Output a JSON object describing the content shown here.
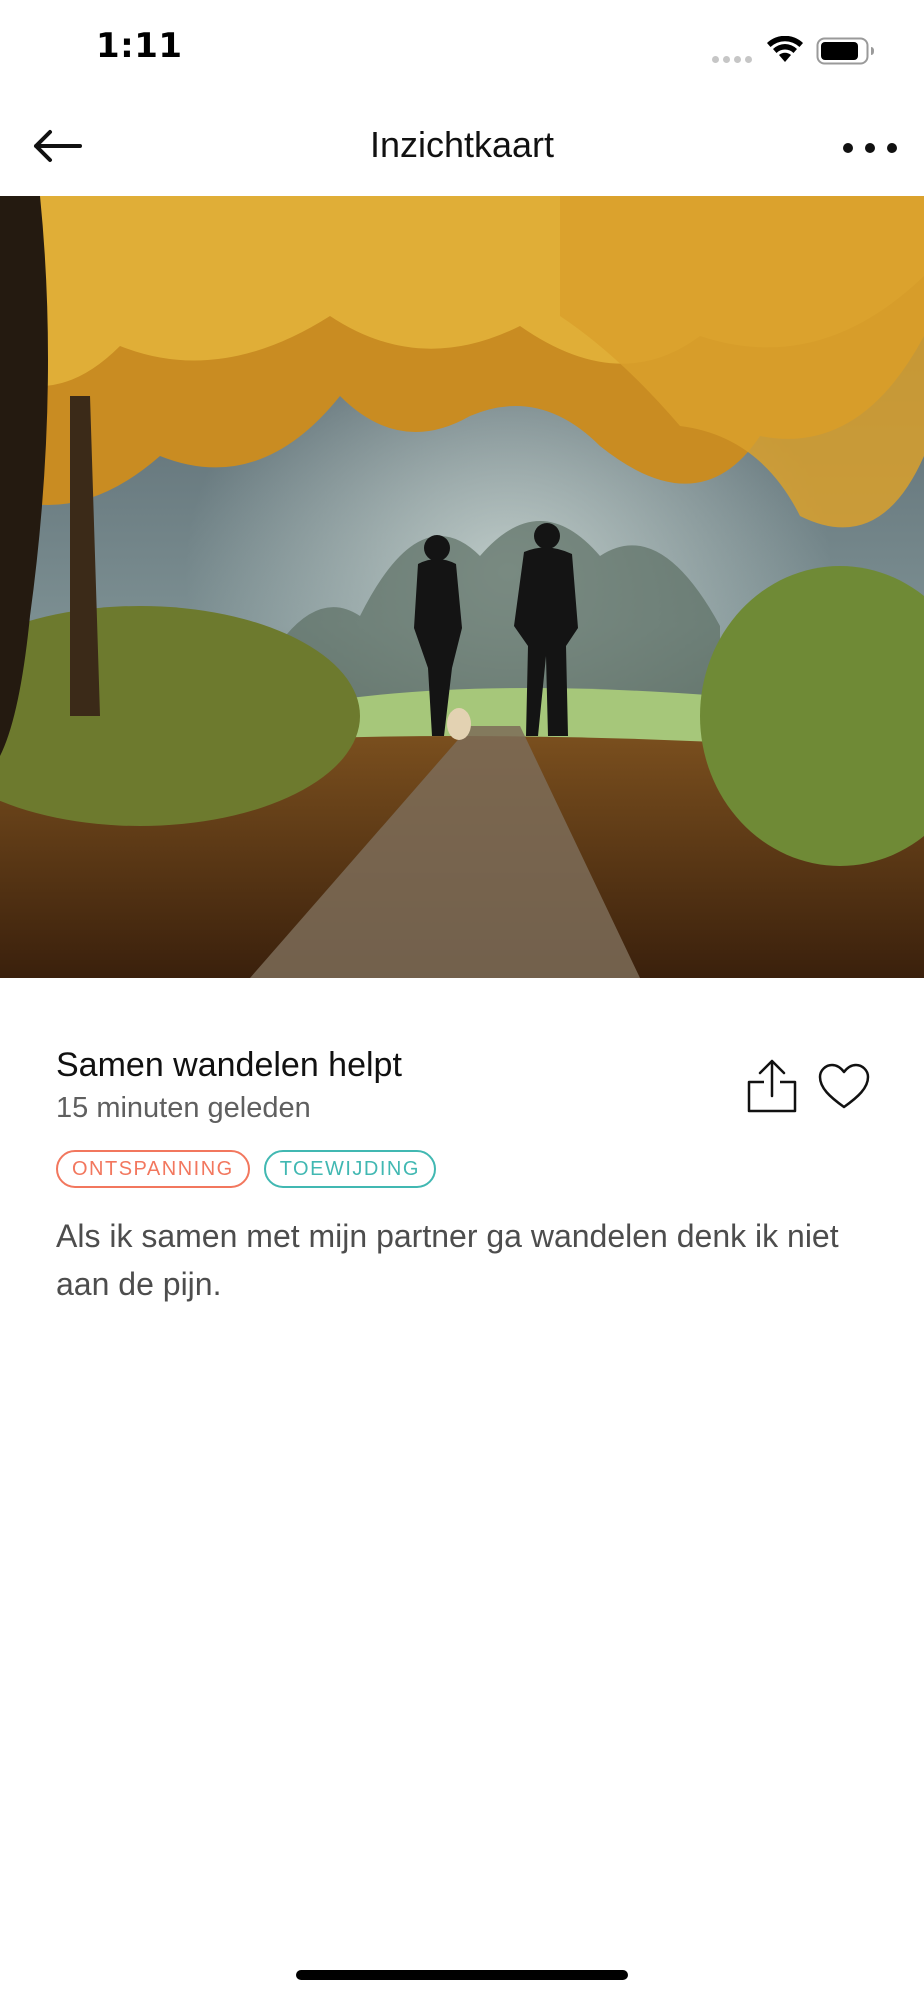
{
  "status_bar": {
    "time": "1:11",
    "icons": [
      "signal-icon",
      "wifi-icon",
      "battery-icon"
    ]
  },
  "nav": {
    "title": "Inzichtkaart",
    "back_icon": "arrow-left-icon",
    "more_icon": "more-horizontal-icon"
  },
  "hero": {
    "image": "autumn-forest-path-two-people-walking-dog-photo"
  },
  "card": {
    "title": "Samen wandelen helpt",
    "time": "15 minuten geleden",
    "tags": [
      {
        "label": "ONTSPANNING",
        "color": "#f2775e"
      },
      {
        "label": "TOEWIJDING",
        "color": "#41b8b2"
      }
    ],
    "body": "Als ik samen met mijn partner ga wandelen denk ik niet aan de pijn.",
    "share_icon": "share-icon",
    "like_icon": "heart-icon"
  }
}
